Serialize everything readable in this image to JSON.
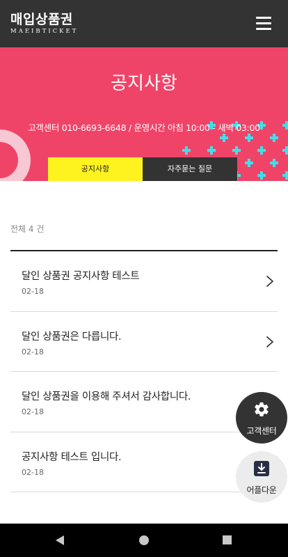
{
  "header": {
    "logo_main": "매입상품권",
    "logo_sub": "MAEIBTICKET",
    "menu_icon": "hamburger-menu-icon"
  },
  "banner": {
    "title": "공지사항",
    "info": "고객센터 010-6693-6648 / 운영시간 아침 10:00 - 새벽 03:00",
    "tabs": [
      {
        "label": "공지사항",
        "active": true
      },
      {
        "label": "자주묻는 질문",
        "active": false
      }
    ],
    "colors": {
      "background": "#ef4468",
      "tab_active": "#fff31f",
      "tab_inactive": "#333333",
      "crosses": "#3ee0ea",
      "ring": "#f7c7d3"
    }
  },
  "list": {
    "total": "전체 4 건",
    "items": [
      {
        "title": "달인 상품권 공지사항 테스트",
        "date": "02-18",
        "has_arrow": true
      },
      {
        "title": "달인 상품권은 다릅니다.",
        "date": "02-18",
        "has_arrow": true
      },
      {
        "title": "달인 상품권을 이용해 주셔서 감사합니다.",
        "date": "02-18",
        "has_arrow": false
      },
      {
        "title": "공지사항 테스트 입니다.",
        "date": "02-18",
        "has_arrow": false
      }
    ]
  },
  "floating": {
    "support_label": "고객센터",
    "support_icon": "gear-icon",
    "app_label": "어플다운",
    "app_icon": "download-icon"
  },
  "navbar": {
    "back_icon": "back-triangle-icon",
    "home_icon": "home-circle-icon",
    "recents_icon": "recents-square-icon"
  }
}
